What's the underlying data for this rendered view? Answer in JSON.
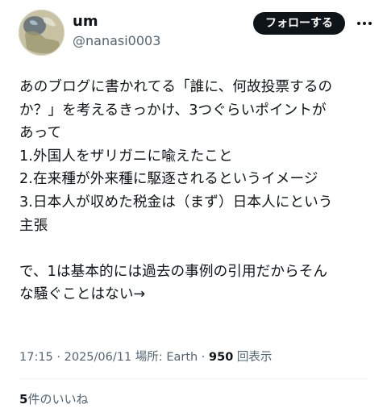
{
  "user": {
    "display_name": "um",
    "handle": "@nanasi0003",
    "follow_label": "フォローする"
  },
  "icons": {
    "avatar": "globe-avatar",
    "more": "more-horizontal-icon"
  },
  "tweet": {
    "lines": [
      "あのブログに書かれてる「誰に、何故投票するの",
      "か？」を考えるきっかけ、3つぐらいポイントが",
      "あって",
      "1.外国人をザリガニに喩えたこと",
      "2.在来種が外来種に駆逐されるというイメージ",
      "3.日本人が収めた税金は（まず）日本人にという",
      "主張",
      "",
      "で、1は基本的には過去の事例の引用だからそん",
      "な騒ぐことはない→"
    ]
  },
  "meta": {
    "time": "17:15",
    "sep1": " · ",
    "date": "2025/06/11",
    "location_label": "場所: ",
    "location": "Earth",
    "sep2": " · ",
    "views_count": "950",
    "views_label": "回表示"
  },
  "engagement": {
    "likes_count": "5",
    "likes_label": "件のいいね"
  },
  "colors": {
    "text": "#0f1419",
    "secondary": "#536471",
    "button_bg": "#0f1419",
    "button_text": "#ffffff",
    "divider": "#eff3f4"
  }
}
